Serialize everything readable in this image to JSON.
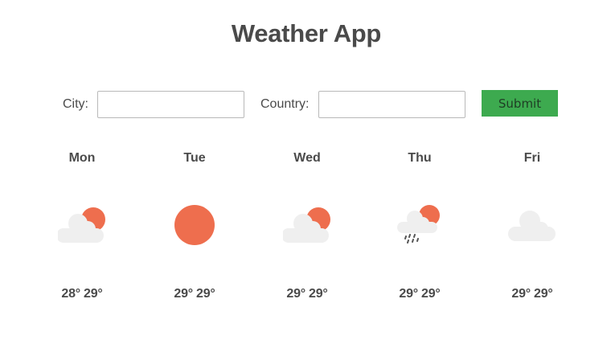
{
  "app": {
    "title": "Weather App"
  },
  "form": {
    "city_label": "City:",
    "city_value": "",
    "country_label": "Country:",
    "country_value": "",
    "submit_label": "Submit"
  },
  "colors": {
    "sun": "#ee6e4e",
    "cloud": "#efefef",
    "rain": "#555555",
    "submit": "#3daa4f"
  },
  "forecast": [
    {
      "day": "Mon",
      "icon": "partly-cloudy-icon",
      "low": "28°",
      "high": "29°"
    },
    {
      "day": "Tue",
      "icon": "sun-icon",
      "low": "29°",
      "high": "29°"
    },
    {
      "day": "Wed",
      "icon": "partly-cloudy-icon",
      "low": "29°",
      "high": "29°"
    },
    {
      "day": "Thu",
      "icon": "rain-sun-icon",
      "low": "29°",
      "high": "29°"
    },
    {
      "day": "Fri",
      "icon": "cloud-icon",
      "low": "29°",
      "high": "29°"
    }
  ]
}
